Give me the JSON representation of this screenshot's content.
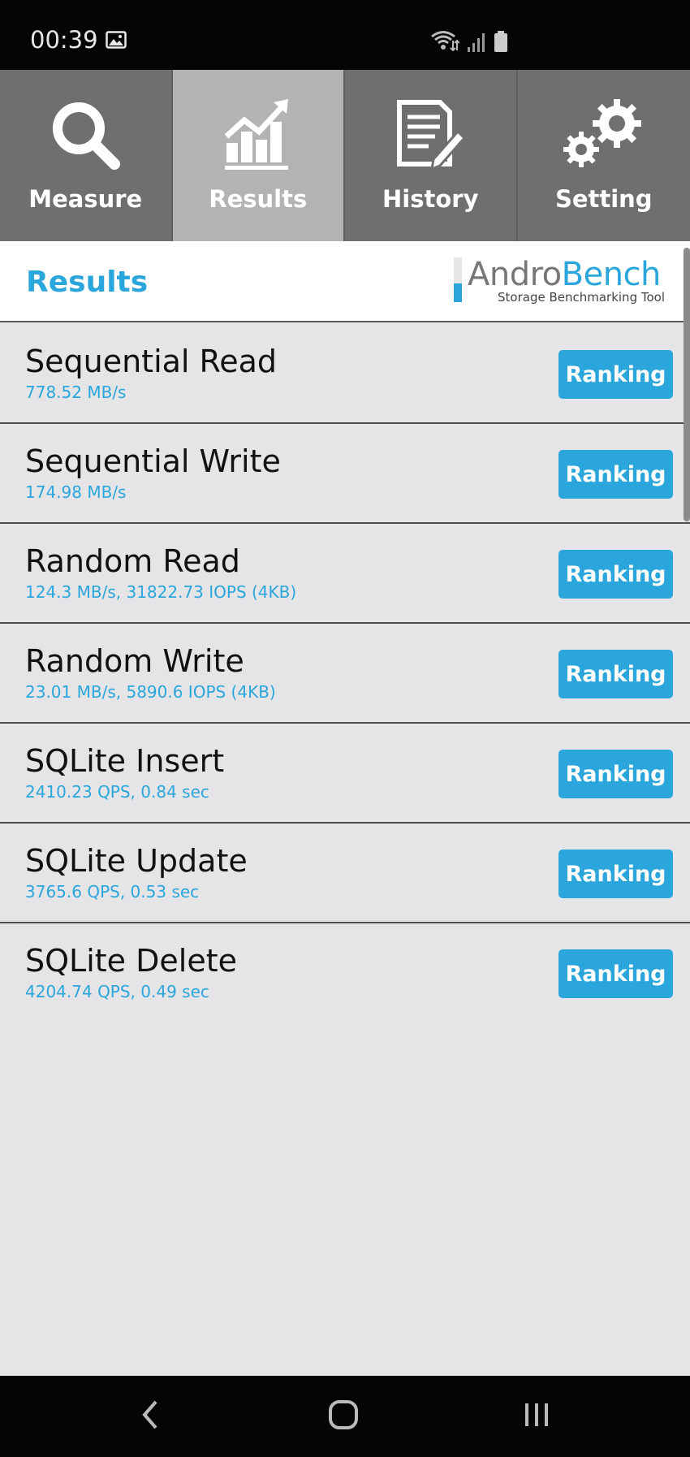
{
  "status_bar": {
    "time": "00:39",
    "icons": [
      "gallery-icon",
      "wifi-icon",
      "signal-icon",
      "battery-icon"
    ]
  },
  "tabs": [
    {
      "label": "Measure",
      "icon": "magnifier-icon",
      "active": false
    },
    {
      "label": "Results",
      "icon": "chart-icon",
      "active": true
    },
    {
      "label": "History",
      "icon": "document-pencil-icon",
      "active": false
    },
    {
      "label": "Setting",
      "icon": "gears-icon",
      "active": false
    }
  ],
  "header": {
    "title": "Results",
    "logo_name_1": "Andro",
    "logo_name_2": "Bench",
    "logo_subtitle": "Storage Benchmarking Tool"
  },
  "results": [
    {
      "name": "Sequential Read",
      "value": "778.52 MB/s",
      "button": "Ranking"
    },
    {
      "name": "Sequential Write",
      "value": "174.98 MB/s",
      "button": "Ranking"
    },
    {
      "name": "Random Read",
      "value": "124.3 MB/s, 31822.73 IOPS (4KB)",
      "button": "Ranking"
    },
    {
      "name": "Random Write",
      "value": "23.01 MB/s, 5890.6 IOPS (4KB)",
      "button": "Ranking"
    },
    {
      "name": "SQLite Insert",
      "value": "2410.23 QPS, 0.84 sec",
      "button": "Ranking"
    },
    {
      "name": "SQLite Update",
      "value": "3765.6 QPS, 0.53 sec",
      "button": "Ranking"
    },
    {
      "name": "SQLite Delete",
      "value": "4204.74 QPS, 0.49 sec",
      "button": "Ranking"
    }
  ],
  "colors": {
    "accent": "#2aa6dc",
    "tab_bg": "#6f6f6f",
    "tab_active_bg": "#b3b3b3",
    "list_bg": "#e5e5e7"
  },
  "navbar": {
    "buttons": [
      "back-icon",
      "home-icon",
      "recents-icon"
    ]
  }
}
